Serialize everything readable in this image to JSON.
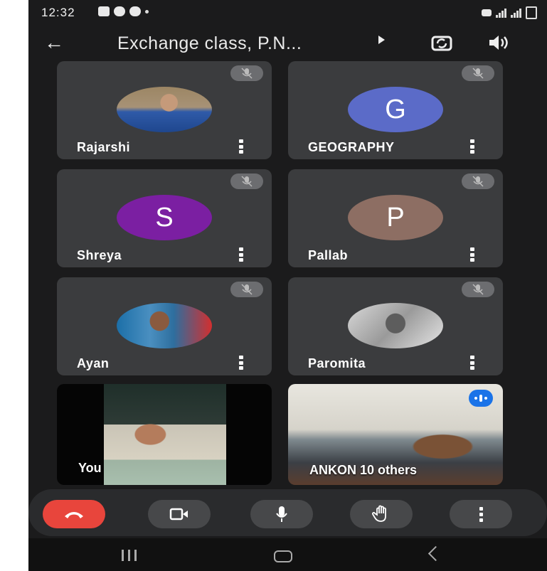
{
  "status_bar": {
    "time": "12:32"
  },
  "app_bar": {
    "title": "Exchange class, P.N..."
  },
  "participants": [
    {
      "name": "Rajarshi",
      "type": "photo",
      "muted": true
    },
    {
      "name": "GEOGRAPHY",
      "type": "initial",
      "initial": "G",
      "color": "#5b6bc8",
      "muted": true
    },
    {
      "name": "Shreya",
      "type": "initial",
      "initial": "S",
      "color": "#7b1fa2",
      "muted": true
    },
    {
      "name": "Pallab",
      "type": "initial",
      "initial": "P",
      "color": "#8d6e63",
      "muted": true
    },
    {
      "name": "Ayan",
      "type": "photo",
      "muted": true
    },
    {
      "name": "Paromita",
      "type": "photo",
      "muted": true
    }
  ],
  "self_tile": {
    "label": "You"
  },
  "group_tile": {
    "label": "ANKON  10 others"
  },
  "controls": {
    "end_call_color": "#e8453c",
    "items": [
      "end-call",
      "camera",
      "microphone",
      "raise-hand",
      "more-options"
    ]
  },
  "nav": [
    "recent-apps",
    "home",
    "back"
  ]
}
